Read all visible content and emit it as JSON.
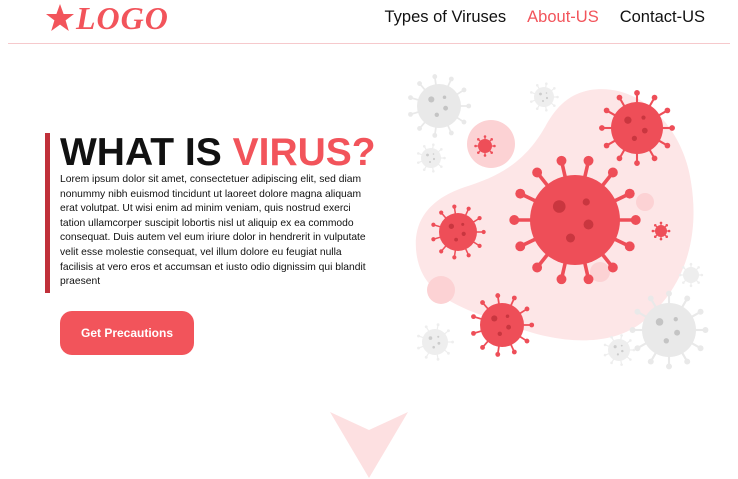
{
  "brand": {
    "logo_text": "LOGO",
    "accent_color": "#f2545b",
    "dark_accent": "#c0303a"
  },
  "nav": {
    "items": [
      {
        "label": "Types of Viruses",
        "active": false
      },
      {
        "label": "About-US",
        "active": true
      },
      {
        "label": "Contact-US",
        "active": false
      }
    ]
  },
  "hero": {
    "title_prefix": "WHAT IS ",
    "title_accent": "VIRUS?",
    "body": "Lorem ipsum dolor sit amet, consectetuer adipiscing elit, sed diam nonummy nibh euismod tincidunt ut laoreet dolore magna aliquam erat volutpat. Ut wisi enim ad minim veniam, quis nostrud exerci tation ullamcorper suscipit lobortis nisl ut aliquip ex ea commodo consequat. Duis autem vel eum iriure dolor in hendrerit in vulputate velit esse molestie consequat, vel illum dolore eu feugiat nulla facilisis at vero eros et accumsan et iusto odio dignissim qui blandit praesent",
    "cta_label": "Get Precautions"
  },
  "illustration": {
    "icon": "virus-cluster-illustration"
  },
  "scroll_hint": {
    "icon": "down-arrow-icon"
  }
}
